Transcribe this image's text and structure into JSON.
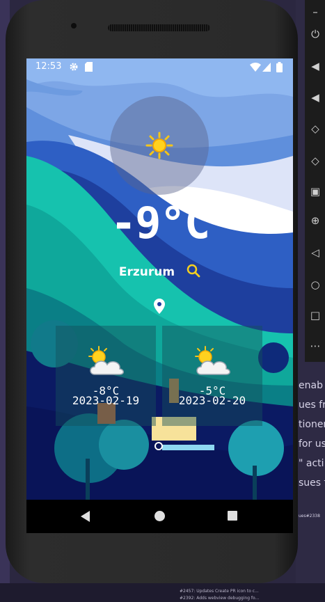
{
  "status_bar": {
    "time": "12:53"
  },
  "weather": {
    "current_temp": "-9°C",
    "city": "Erzurum",
    "current_icon": "sun-icon"
  },
  "forecast": [
    {
      "temp": "-8°C",
      "date": "2023-02-19",
      "icon": "partly-cloudy-icon"
    },
    {
      "temp": "-5°C",
      "date": "2023-02-20",
      "icon": "partly-cloudy-icon"
    }
  ],
  "navigation": {
    "back": "back-icon",
    "home": "home-icon",
    "recents": "recents-icon"
  },
  "background_window": {
    "right_snippets": [
      "enab",
      "ues fro",
      "tioner",
      "for us",
      "\" acti",
      "sues f"
    ],
    "taskbar_lines": [
      "#2457: Updates Create PR icon to c...",
      "#2392: Adds webview debugging fo..."
    ],
    "issue_tag": "ues#2338"
  },
  "colors": {
    "sky": "#7fa8e8",
    "teal": "#16c6b4",
    "navy": "#0f1f6a",
    "accent_icon": "#f5d020"
  }
}
